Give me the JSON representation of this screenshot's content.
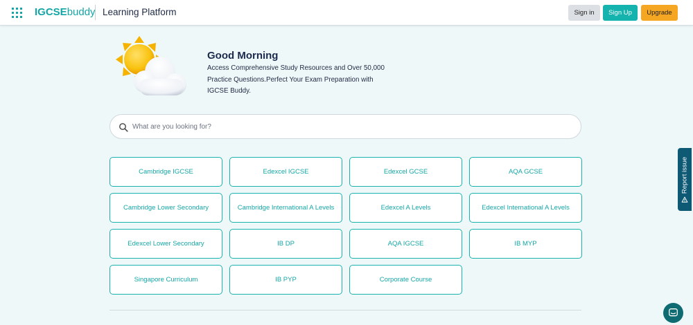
{
  "header": {
    "logo_bold": "IGCSE",
    "logo_light": "buddy",
    "platform_title": "Learning Platform",
    "signin_label": "Sign in",
    "signup_label": "Sign Up",
    "upgrade_label": "Upgrade"
  },
  "hero": {
    "greeting": "Good Morning",
    "subtitle": "Access Comprehensive Study Resources and Over 50,000 Practice Questions.Perfect Your Exam Preparation with IGCSE Buddy.",
    "icon": "sun-cloud-icon"
  },
  "search": {
    "placeholder": "What are you looking for?",
    "value": ""
  },
  "curricula": [
    "Cambridge IGCSE",
    "Edexcel IGCSE",
    "Edexcel GCSE",
    "AQA GCSE",
    "Cambridge Lower Secondary",
    "Cambridge International A Levels",
    "Edexcel A Levels",
    "Edexcel International A Levels",
    "Edexcel Lower Secondary",
    "IB DP",
    "AQA IGCSE",
    "IB MYP",
    "Singapore Curriculum",
    "IB PYP",
    "Corporate Course"
  ],
  "report": {
    "label": "Report issue",
    "icon": "warning-icon"
  },
  "chat": {
    "icon": "chat-icon"
  },
  "colors": {
    "accent": "#14a6a6",
    "signup": "#14b3ad",
    "upgrade": "#f5a623",
    "report_tab": "#0e5a75",
    "background": "#eef8f8"
  }
}
